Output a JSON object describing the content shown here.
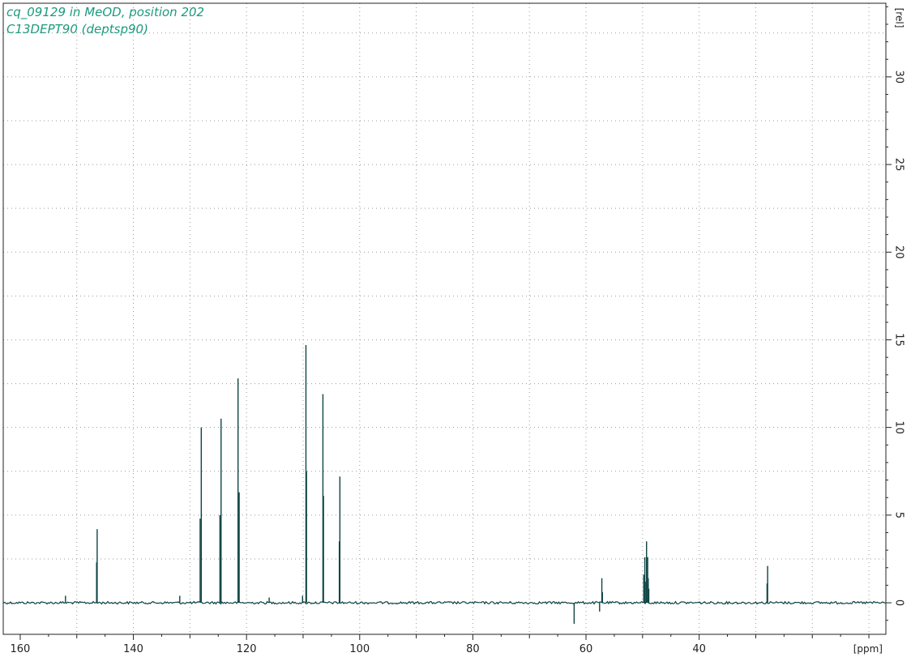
{
  "window": {
    "title_line1": "cq_09129 in MeOD, position 202",
    "title_line2": "C13DEPT90 (deptsp90)"
  },
  "colors": {
    "spectrum": "#0e4444",
    "title": "#1a9a7e",
    "grid": "#9a9a9a",
    "frame": "#222222"
  },
  "chart_data": {
    "type": "line",
    "title": "cq_09129 in MeOD, position 202",
    "subtitle": "C13DEPT90 (deptsp90)",
    "xlabel": "[ppm]",
    "ylabel": "[rel]",
    "x_reversed": true,
    "xlim": [
      163.0,
      7.0
    ],
    "ylim": [
      -1.8,
      34.2
    ],
    "x_ticks": [
      160,
      140,
      120,
      100,
      80,
      60,
      40
    ],
    "y_ticks": [
      0,
      5,
      10,
      15,
      20,
      25,
      30
    ],
    "grid": true,
    "grid_style": "dotted",
    "series": [
      {
        "peaks": [
          {
            "ppm": 146.4,
            "height": 4.2
          },
          {
            "ppm": 146.5,
            "height": 2.3
          },
          {
            "ppm": 152.0,
            "height": 0.4
          },
          {
            "ppm": 131.8,
            "height": 0.4
          },
          {
            "ppm": 128.0,
            "height": 10.0
          },
          {
            "ppm": 128.2,
            "height": 4.8
          },
          {
            "ppm": 124.5,
            "height": 10.5
          },
          {
            "ppm": 124.7,
            "height": 5.0
          },
          {
            "ppm": 121.5,
            "height": 12.8
          },
          {
            "ppm": 121.3,
            "height": 6.3
          },
          {
            "ppm": 116.0,
            "height": 0.3
          },
          {
            "ppm": 110.1,
            "height": 0.4
          },
          {
            "ppm": 109.5,
            "height": 14.7
          },
          {
            "ppm": 109.4,
            "height": 7.5
          },
          {
            "ppm": 106.5,
            "height": 11.9
          },
          {
            "ppm": 106.4,
            "height": 6.1
          },
          {
            "ppm": 103.5,
            "height": 7.2
          },
          {
            "ppm": 103.6,
            "height": 3.5
          },
          {
            "ppm": 62.1,
            "height": -1.2
          },
          {
            "ppm": 57.6,
            "height": -0.5
          },
          {
            "ppm": 57.2,
            "height": 1.4
          },
          {
            "ppm": 57.1,
            "height": 0.6
          },
          {
            "ppm": 49.8,
            "height": 1.6
          },
          {
            "ppm": 49.6,
            "height": 2.6
          },
          {
            "ppm": 49.4,
            "height": 1.2
          },
          {
            "ppm": 49.3,
            "height": 3.5
          },
          {
            "ppm": 49.1,
            "height": 2.6
          },
          {
            "ppm": 49.0,
            "height": 1.4
          },
          {
            "ppm": 48.9,
            "height": 0.8
          },
          {
            "ppm": 27.9,
            "height": 2.1
          },
          {
            "ppm": 28.0,
            "height": 1.1
          }
        ]
      }
    ]
  }
}
